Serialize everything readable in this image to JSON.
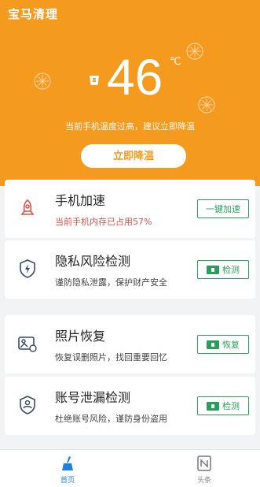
{
  "app": {
    "title": "宝马清理"
  },
  "hero": {
    "temperature": "46",
    "unit": "℃",
    "warning": "当前手机温度过高，建议立即降温",
    "cool_button": "立即降温"
  },
  "cards": [
    {
      "title": "手机加速",
      "subtitle": "当前手机内存已占用57%",
      "action": "一键加速",
      "icon": "rocket-icon"
    },
    {
      "title": "隐私风险检测",
      "subtitle": "谨防隐私泄露，保护财产安全",
      "action": "检测",
      "icon": "shield-bolt-icon"
    },
    {
      "title": "照片恢复",
      "subtitle": "恢复误删照片，找回重要回忆",
      "action": "恢复",
      "icon": "photo-restore-icon"
    },
    {
      "title": "账号泄漏检测",
      "subtitle": "杜绝账号风险，谨防身份盗用",
      "action": "检测",
      "icon": "user-shield-icon"
    }
  ],
  "tabs": [
    {
      "label": "首页",
      "icon": "broom-icon",
      "active": true
    },
    {
      "label": "头条",
      "icon": "news-icon",
      "active": false
    }
  ],
  "colors": {
    "brand": "#f39a1f",
    "action": "#2a9d5c",
    "alert": "#e0504a"
  }
}
